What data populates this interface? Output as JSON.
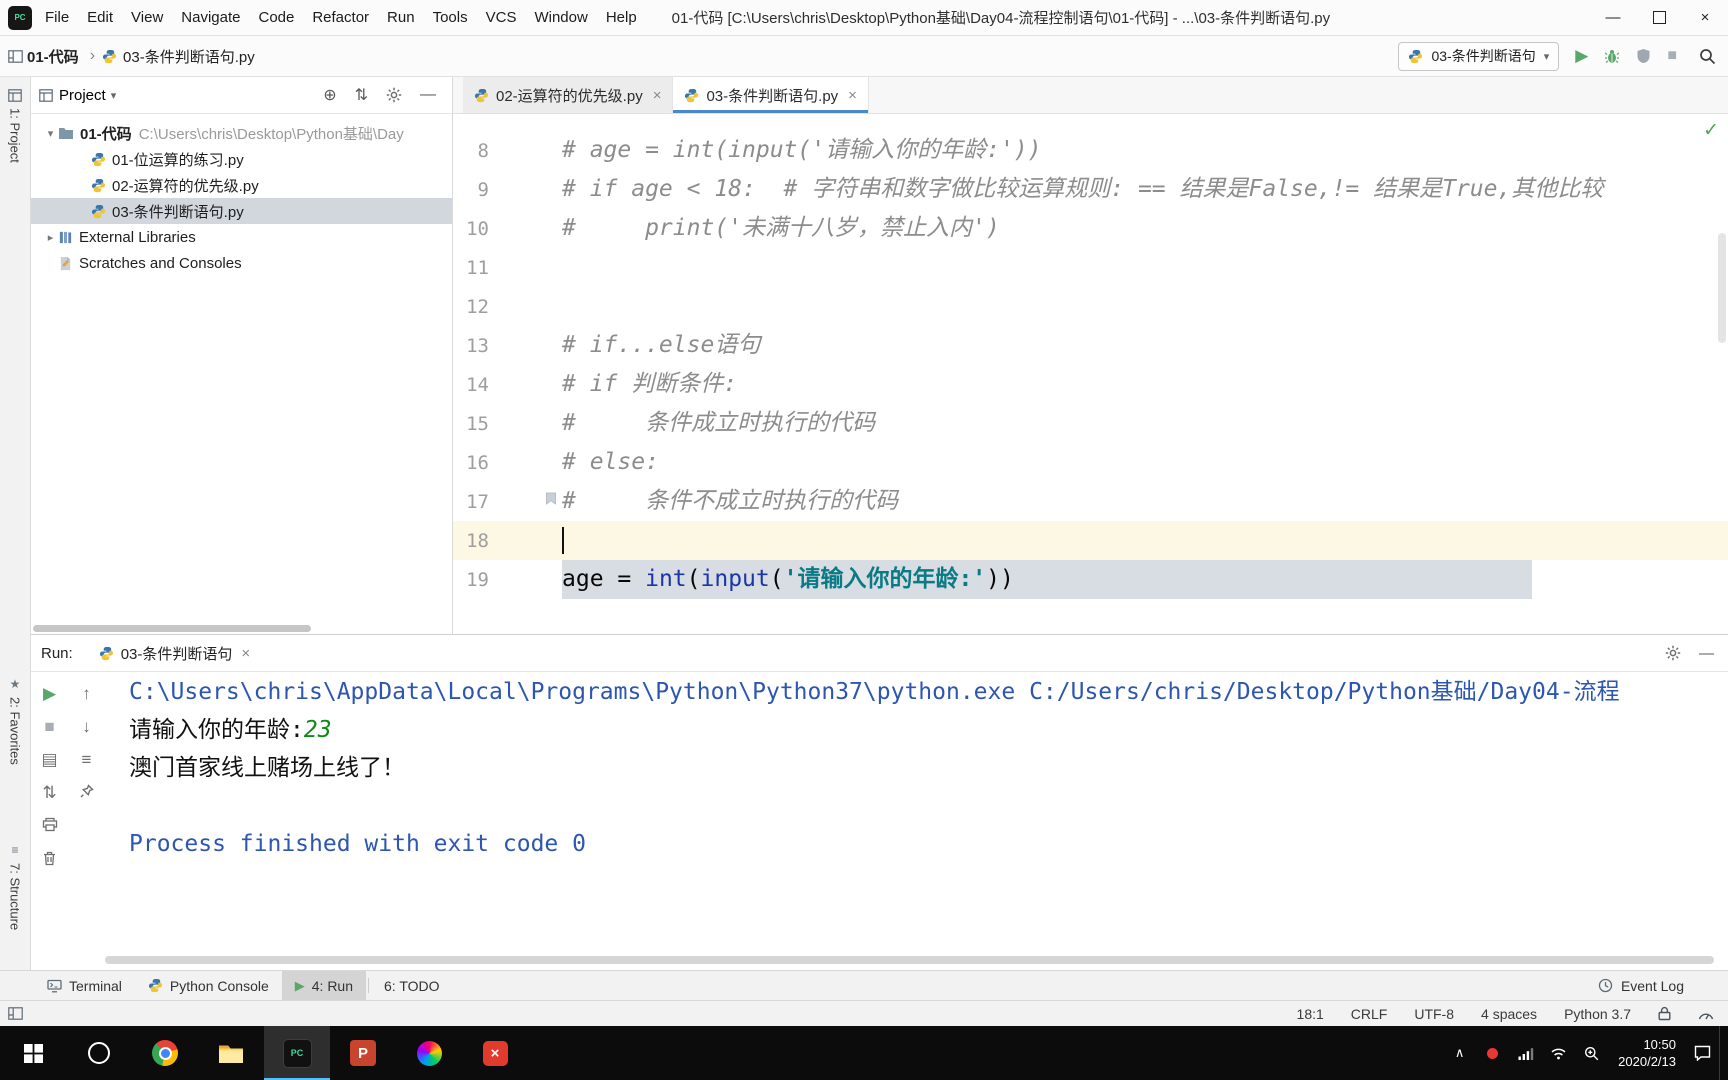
{
  "colors": {
    "accent_blue": "#4A88C7",
    "run_green": "#59A869",
    "caret_line_bg": "#FCF8E3",
    "selection_bg": "#D8DCE3",
    "comment": "#8C8C8C",
    "builtin": "#1A36A8",
    "string": "#0A7A85",
    "console_system_blue": "#2C56B0",
    "console_input_green": "#0E8A16",
    "taskbar_bg": "#0C0C0C"
  },
  "icons": {
    "pycharm_logo": "PC",
    "chevron": "›",
    "caret_down": "▾",
    "caret_right": "▸",
    "run": "▶",
    "stop": "■",
    "locate": "⊕",
    "collapse": "⇅",
    "hide": "—",
    "check": "✓",
    "close": "×",
    "minimize": "—",
    "star": "★",
    "structure_glyph": "≡",
    "tray_chevron": "∧",
    "ppt_letter": "P",
    "red_app_glyph": "×"
  },
  "titlebar": {
    "menu_items": [
      "File",
      "Edit",
      "View",
      "Navigate",
      "Code",
      "Refactor",
      "Run",
      "Tools",
      "VCS",
      "Window",
      "Help"
    ],
    "title": "01-代码 [C:\\Users\\chris\\Desktop\\Python基础\\Day04-流程控制语句\\01-代码] - ...\\03-条件判断语句.py"
  },
  "toolbar": {
    "breadcrumbs": [
      "01-代码",
      "03-条件判断语句.py"
    ],
    "run_config": "03-条件判断语句"
  },
  "stripe": {
    "project": "1: Project",
    "favorites": "2: Favorites",
    "structure": "7: Structure"
  },
  "project_panel": {
    "header": "Project",
    "tree": [
      {
        "kind": "root",
        "label": "01-代码",
        "path": "C:\\Users\\chris\\Desktop\\Python基础\\Day"
      },
      {
        "kind": "file",
        "label": "01-位运算的练习.py"
      },
      {
        "kind": "file",
        "label": "02-运算符的优先级.py"
      },
      {
        "kind": "file",
        "label": "03-条件判断语句.py",
        "selected": true
      },
      {
        "kind": "branch",
        "label": "External Libraries",
        "icon": "library"
      },
      {
        "kind": "leaf",
        "label": "Scratches and Consoles",
        "icon": "scratch"
      }
    ]
  },
  "editor": {
    "tabs": [
      {
        "label": "02-运算符的优先级.py",
        "active": false
      },
      {
        "label": "03-条件判断语句.py",
        "active": true
      }
    ],
    "lines": [
      {
        "num": "8",
        "kind": "comment",
        "text": "# age = int(input('请输入你的年龄:'))"
      },
      {
        "num": "9",
        "kind": "comment",
        "text": "# if age < 18:  # 字符串和数字做比较运算规则: == 结果是False,!= 结果是True,其他比较"
      },
      {
        "num": "10",
        "kind": "comment",
        "text": "#     print('未满十八岁，禁止入内')"
      },
      {
        "num": "11",
        "kind": "empty",
        "text": ""
      },
      {
        "num": "12",
        "kind": "empty",
        "text": ""
      },
      {
        "num": "13",
        "kind": "comment",
        "text": "# if...else语句"
      },
      {
        "num": "14",
        "kind": "comment",
        "text": "# if 判断条件:"
      },
      {
        "num": "15",
        "kind": "comment",
        "text": "#     条件成立时执行的代码"
      },
      {
        "num": "16",
        "kind": "comment",
        "text": "# else:"
      },
      {
        "num": "17",
        "kind": "comment",
        "text": "#     条件不成立时执行的代码",
        "gutter_icon": true
      },
      {
        "num": "18",
        "kind": "caret",
        "text": ""
      },
      {
        "num": "19",
        "kind": "code",
        "selected": true,
        "tokens": [
          {
            "t": "age = ",
            "c": "plain"
          },
          {
            "t": "int",
            "c": "builtin"
          },
          {
            "t": "(",
            "c": "plain"
          },
          {
            "t": "input",
            "c": "builtin"
          },
          {
            "t": "(",
            "c": "plain"
          },
          {
            "t": "'请输入你的年龄:'",
            "c": "string"
          },
          {
            "t": "))",
            "c": "plain"
          }
        ]
      }
    ]
  },
  "run_panel": {
    "label": "Run:",
    "tab": "03-条件判断语句",
    "toolbar": {
      "col1": [
        {
          "name": "rerun-icon",
          "glyph": "▶",
          "color": "#59A869"
        },
        {
          "name": "stop-icon",
          "glyph": "■",
          "color": "#A7ADB3"
        },
        {
          "name": "restore-layout-icon",
          "glyph": "▤"
        },
        {
          "name": "scroll-to-end-icon",
          "glyph": "⇅"
        },
        {
          "name": "print-icon",
          "svg": "print"
        },
        {
          "name": "clear-all-icon",
          "svg": "trash"
        }
      ],
      "col2": [
        {
          "name": "up-stack-trace-icon",
          "glyph": "↑"
        },
        {
          "name": "down-stack-trace-icon",
          "glyph": "↓"
        },
        {
          "name": "soft-wrap-icon",
          "glyph": "≡"
        },
        {
          "name": "pin-tab-icon",
          "svg": "pin"
        }
      ]
    },
    "console": [
      {
        "kind": "command",
        "text": "C:\\Users\\chris\\AppData\\Local\\Programs\\Python\\Python37\\python.exe C:/Users/chris/Desktop/Python基础/Day04-流程"
      },
      {
        "kind": "prompt",
        "text": "请输入你的年龄:",
        "input": "23"
      },
      {
        "kind": "stdout",
        "text": "澳门首家线上赌场上线了！"
      },
      {
        "kind": "empty",
        "text": ""
      },
      {
        "kind": "system",
        "text": "Process finished with exit code 0"
      }
    ]
  },
  "bottom_bar": {
    "items": [
      {
        "label": "Terminal",
        "icon": "terminal"
      },
      {
        "label": "Python Console",
        "icon": "python"
      },
      {
        "label": "4: Run",
        "icon": "run",
        "active": true
      },
      {
        "label": "6: TODO",
        "icon": "none",
        "divider_before": true
      }
    ],
    "event_log": "Event Log"
  },
  "status_bar": {
    "items": [
      "18:1",
      "CRLF",
      "UTF-8",
      "4 spaces",
      "Python 3.7"
    ]
  },
  "taskbar": {
    "time": "10:50",
    "date": "2020/2/13"
  }
}
